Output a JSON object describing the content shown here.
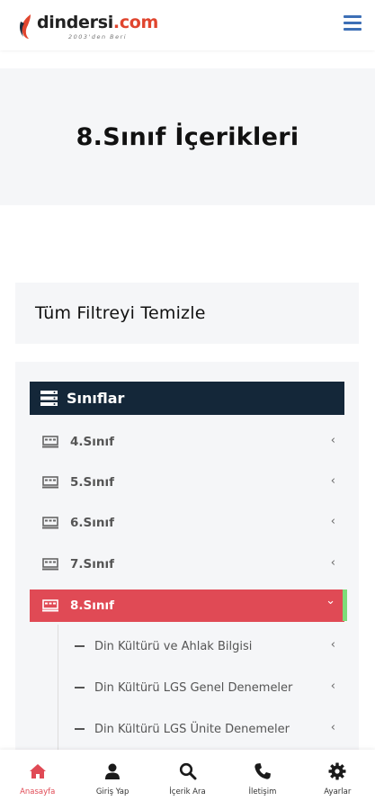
{
  "header": {
    "logo_main": "dindersi",
    "logo_domain": ".com",
    "logo_slogan": "2003'den Beri"
  },
  "hero": {
    "title": "8.Sınıf İçerikleri"
  },
  "filter": {
    "clear_label": "Tüm Filtreyi Temizle"
  },
  "categories": {
    "header_label": "Sınıflar",
    "items": [
      {
        "label": "4.Sınıf",
        "chevron": "‹"
      },
      {
        "label": "5.Sınıf",
        "chevron": "‹"
      },
      {
        "label": "6.Sınıf",
        "chevron": "‹"
      },
      {
        "label": "7.Sınıf",
        "chevron": "‹"
      },
      {
        "label": "8.Sınıf",
        "chevron": "⌄",
        "active": true
      }
    ],
    "sub_items": [
      {
        "label": "Din Kültürü ve Ahlak Bilgisi",
        "chevron": "‹"
      },
      {
        "label": "Din Kültürü LGS Genel Denemeler",
        "chevron": "‹"
      },
      {
        "label": "Din Kültürü LGS Ünite Denemeler",
        "chevron": "‹"
      }
    ]
  },
  "bottom_nav": [
    {
      "label": "Anasayfa",
      "icon": "home-icon",
      "active": true
    },
    {
      "label": "Giriş Yap",
      "icon": "user-icon"
    },
    {
      "label": "İçerik Ara",
      "icon": "search-icon"
    },
    {
      "label": "İletişim",
      "icon": "phone-icon"
    },
    {
      "label": "Ayarlar",
      "icon": "gear-icon"
    }
  ],
  "colors": {
    "accent_red": "#e04a55",
    "header_navy": "#142739",
    "active_indicator_green": "#7ddc78",
    "menu_blue": "#3d6fb6",
    "logo_orange": "#e0452e"
  }
}
